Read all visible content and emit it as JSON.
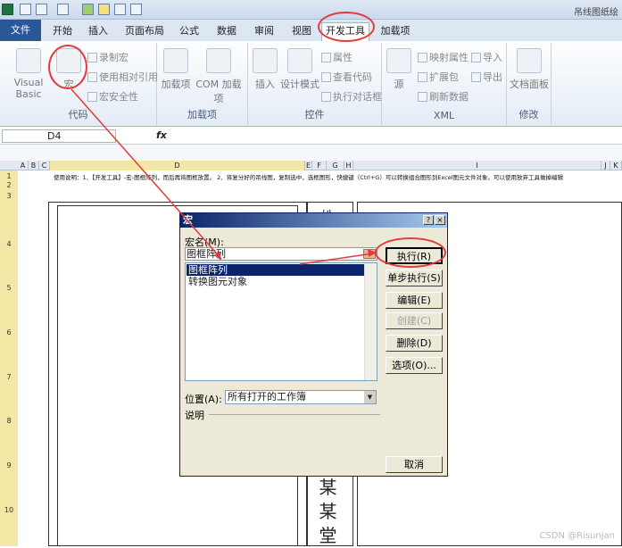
{
  "window": {
    "title": "吊线图纸绘"
  },
  "tabs": [
    "开始",
    "插入",
    "页面布局",
    "公式",
    "数据",
    "审阅",
    "视图",
    "开发工具",
    "加载项"
  ],
  "file_tab": "文件",
  "ribbon": {
    "code": {
      "label": "代码",
      "visual_basic": "Visual Basic",
      "macro": "宏",
      "record": "录制宏",
      "relative": "使用相对引用",
      "security": "宏安全性"
    },
    "addins": {
      "label": "加载项",
      "addin": "加载项",
      "com": "COM 加载项"
    },
    "controls": {
      "label": "控件",
      "insert": "插入",
      "design": "设计模式",
      "props": "属性",
      "view_code": "查看代码",
      "run_dialog": "执行对话框"
    },
    "xml": {
      "label": "XML",
      "source": "源",
      "map_props": "映射属性",
      "import": "导入",
      "expand": "扩展包",
      "export": "导出",
      "refresh": "刷新数据"
    },
    "modify": {
      "label": "修改",
      "doc_panel": "文档面板"
    }
  },
  "namebox": "D4",
  "fx": "fx",
  "columns": [
    "A",
    "B",
    "C",
    "D",
    "E",
    "F",
    "G",
    "H",
    "I",
    "J",
    "K"
  ],
  "rows": [
    "1",
    "2",
    "3",
    "4",
    "5",
    "6",
    "7",
    "8",
    "9",
    "10"
  ],
  "sheet_note": "使用说明：1、【开发工具】-宏-图框阵列，而后再将图框放置。 2、将复分好的吊线图，复制选中，选框图形，快捷键（Ctrl+G）可以转换组合图形到Excel图元文件对象。可以使用放弃工具做掉编辑",
  "sheet_vertical_text_top": "姓",
  "sheet_vertical_text": [
    "某",
    "某",
    "堂"
  ],
  "dialog": {
    "title": "宏",
    "help": "?",
    "close": "×",
    "macro_name_label": "宏名(M):",
    "macro_name_value": "图框阵列",
    "macros": [
      "图框阵列",
      "转换图元对象"
    ],
    "buttons": {
      "run": "执行(R)",
      "step": "单步执行(S)",
      "edit": "编辑(E)",
      "create": "创建(C)",
      "delete": "删除(D)",
      "options": "选项(O)...",
      "cancel": "取消"
    },
    "location_label": "位置(A):",
    "location_value": "所有打开的工作簿",
    "desc_label": "说明"
  },
  "watermark": "CSDN @Risunjan",
  "colors": {
    "accent": "#e23b3b",
    "title_bar": "#0a246a",
    "file_tab": "#2b579a"
  }
}
